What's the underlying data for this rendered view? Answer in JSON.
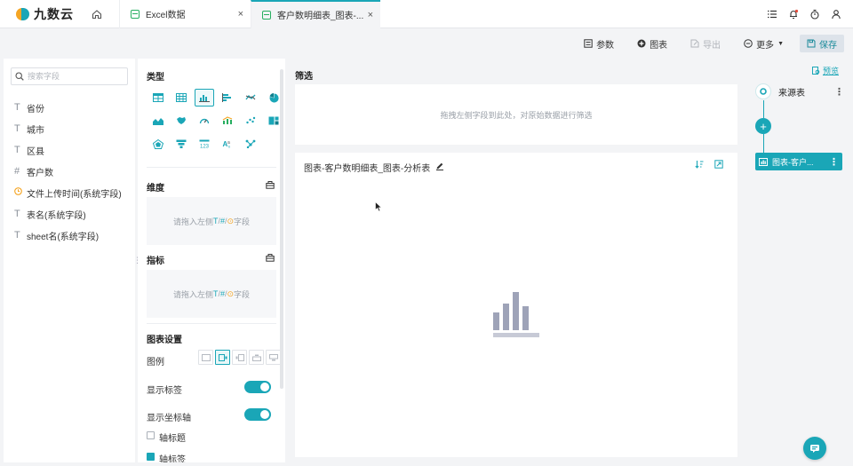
{
  "app": {
    "logo_text": "九数云"
  },
  "tabs": [
    {
      "label": "Excel数据",
      "close": "×"
    },
    {
      "label": "客户数明细表_图表-...",
      "close": "×"
    }
  ],
  "toolbar": {
    "params": "参数",
    "chart": "图表",
    "export": "导出",
    "more": "更多",
    "save": "保存"
  },
  "fields": {
    "search_placeholder": "搜索字段",
    "items": [
      {
        "type": "T",
        "label": "省份"
      },
      {
        "type": "T",
        "label": "城市"
      },
      {
        "type": "T",
        "label": "区县"
      },
      {
        "type": "#",
        "label": "客户数"
      },
      {
        "type": "clock",
        "label": "文件上传时间(系统字段)"
      },
      {
        "type": "T",
        "label": "表名(系统字段)"
      },
      {
        "type": "T",
        "label": "sheet名(系统字段)"
      }
    ]
  },
  "config": {
    "type_title": "类型",
    "dimension_title": "维度",
    "dim_hint_pre": "请拖入左侧",
    "dim_hint_t": "T",
    "dim_hint_sep1": "/",
    "dim_hint_hash": "#",
    "dim_hint_sep2": "/",
    "dim_hint_o": "⊙",
    "dim_hint_post": "字段",
    "metric_title": "指标",
    "settings_title": "图表设置",
    "legend_label": "图例",
    "show_labels": "显示标签",
    "show_axis": "显示坐标轴",
    "axis_title": "轴标题",
    "axis_label": "轴标签"
  },
  "main": {
    "filter_title": "筛选",
    "filter_hint": "拖拽左侧字段到此处，对原始数据进行筛选",
    "chart_title": "图表-客户数明细表_图表-分析表"
  },
  "flow": {
    "preview": "预览",
    "source_label": "来源表",
    "plus": "+",
    "chart_node_label": "图表-客户..."
  },
  "colors": {
    "accent": "#1aa6b7",
    "orange": "#f5a524",
    "green": "#27ae60"
  }
}
